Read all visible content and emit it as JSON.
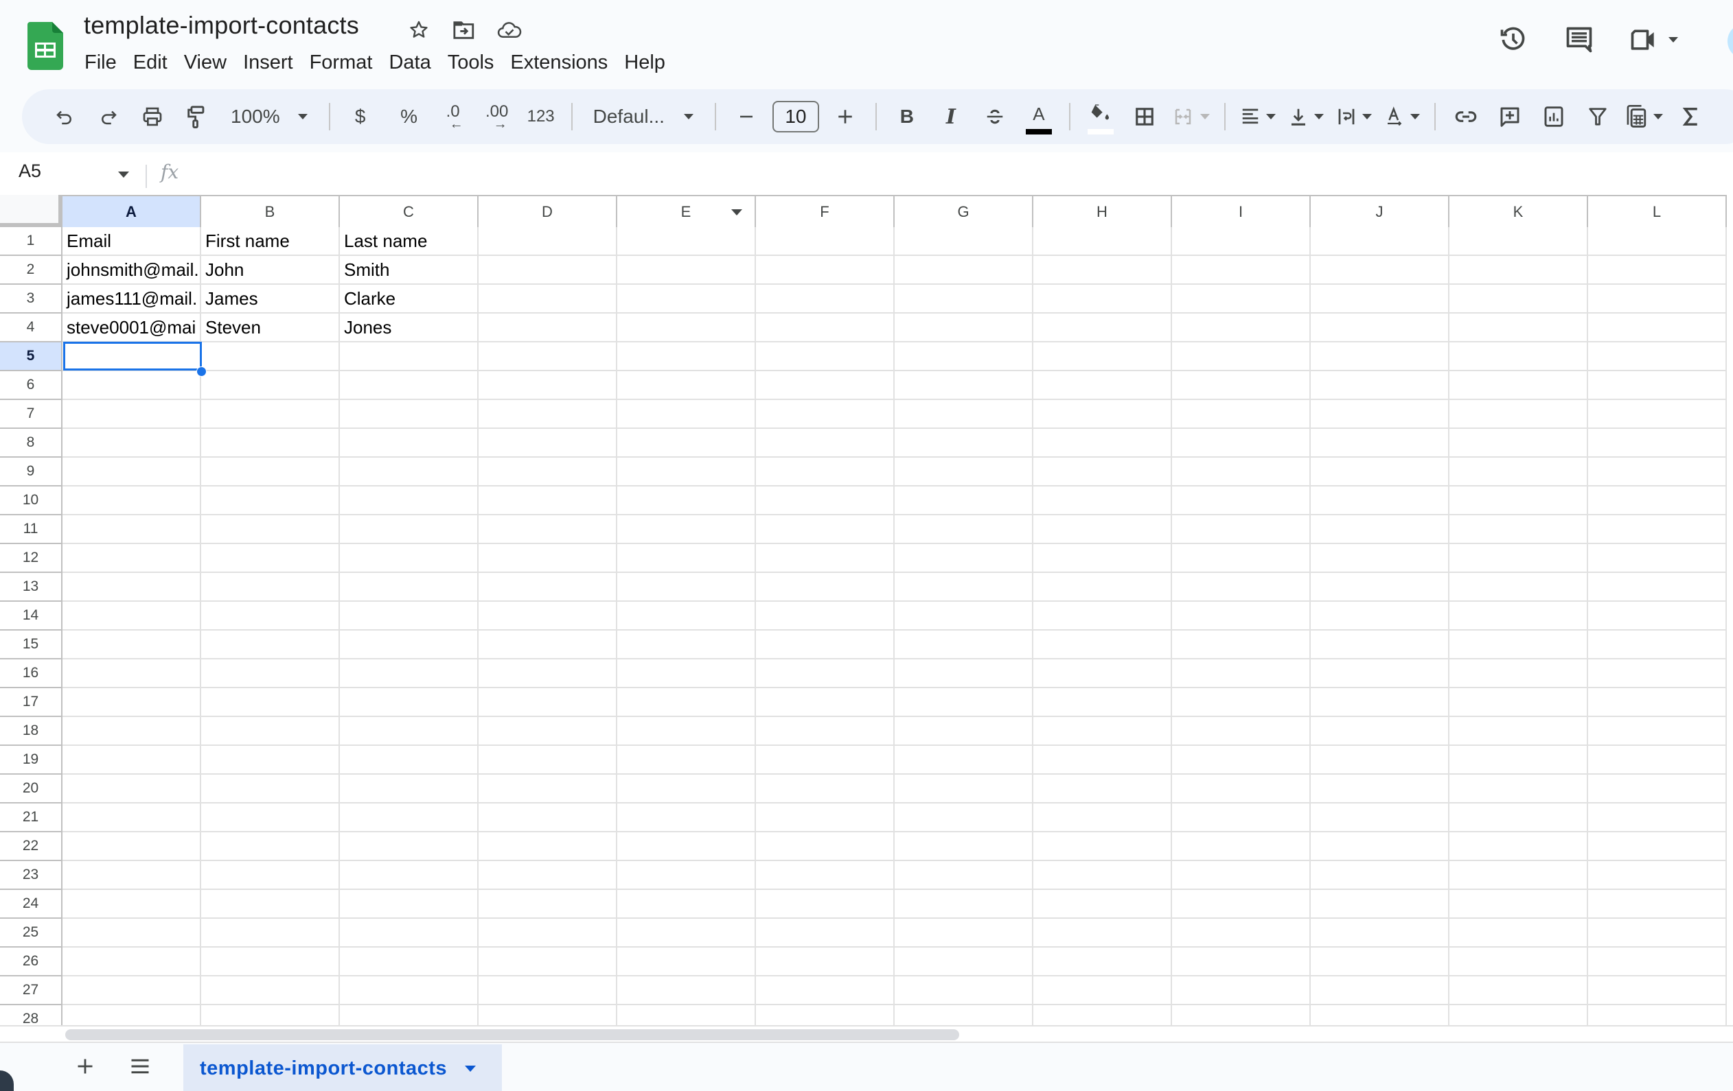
{
  "app": {
    "title": "template-import-contacts",
    "brand_color": "#34a853",
    "title_icons": [
      "star-icon",
      "move-to-folder-icon",
      "cloud-saved-icon"
    ],
    "top_right_icons": [
      "version-history-icon",
      "comments-icon",
      "meet-icon"
    ]
  },
  "menu": [
    "File",
    "Edit",
    "View",
    "Insert",
    "Format",
    "Data",
    "Tools",
    "Extensions",
    "Help"
  ],
  "toolbar": {
    "zoom": "100%",
    "currency": "$",
    "percent": "%",
    "decrease_decimal": ".0",
    "increase_decimal": ".00",
    "number_format": "123",
    "font": "Defaul...",
    "font_size": "10",
    "bold": "B",
    "italic": "I",
    "text_color_label": "A",
    "text_color": "#000000",
    "fill_color": "#ffffff"
  },
  "formula_bar": {
    "name_box": "A5",
    "fx_label": "fx",
    "value": ""
  },
  "grid": {
    "columns": [
      "A",
      "B",
      "C",
      "D",
      "E",
      "F",
      "G",
      "H",
      "I",
      "J",
      "K",
      "L"
    ],
    "selected_column": "A",
    "selected_row": 5,
    "selected_cell": "A5",
    "row_count_visible": 28,
    "rows": [
      [
        "Email",
        "First name",
        "Last name"
      ],
      [
        "johnsmith@mail.",
        "John",
        "Smith"
      ],
      [
        "james111@mail.",
        "James",
        "Clarke"
      ],
      [
        "steve0001@mai",
        "Steven",
        "Jones"
      ]
    ]
  },
  "sheets": {
    "add_label": "+",
    "tabs": [
      {
        "name": "template-import-contacts",
        "active": true
      }
    ]
  }
}
